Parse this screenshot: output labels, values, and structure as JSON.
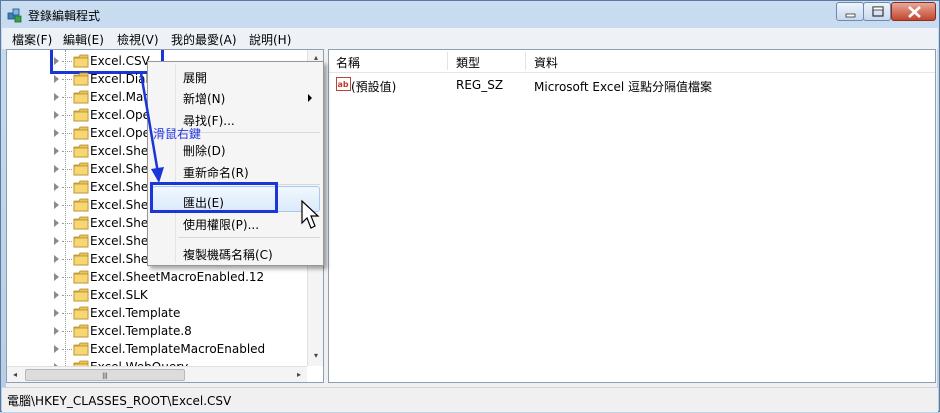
{
  "window": {
    "title": "登錄編輯程式"
  },
  "menubar": {
    "items": [
      "檔案(F)",
      "編輯(E)",
      "檢視(V)",
      "我的最愛(A)",
      "說明(H)"
    ]
  },
  "tree": {
    "items": [
      "Excel.CSV",
      "Excel.Dialo",
      "Excel.Mac",
      "Excel.Ope",
      "Excel.Ope",
      "Excel.Shee",
      "Excel.Shee",
      "Excel.Shee",
      "Excel.Shee",
      "Excel.Shee",
      "Excel.Shee",
      "Excel.Shee",
      "Excel.SheetMacroEnabled.12",
      "Excel.SLK",
      "Excel.Template",
      "Excel.Template.8",
      "Excel.TemplateMacroEnabled",
      "Excel.WebQuery"
    ],
    "scroll_left": "◂",
    "scroll_right": "▸",
    "scroll_up": "▴",
    "scroll_down": "▾",
    "grip": "III"
  },
  "list": {
    "columns": [
      "名稱",
      "類型",
      "資料"
    ],
    "rows": [
      {
        "name": "(預設值)",
        "type": "REG_SZ",
        "data": "Microsoft Excel 逗點分隔值檔案"
      }
    ],
    "value_icon": "ab"
  },
  "context_menu": {
    "items": [
      {
        "label": "展開"
      },
      {
        "label": "新增(N)",
        "submenu": true
      },
      {
        "label": "尋找(F)..."
      },
      {
        "label": "刪除(D)"
      },
      {
        "label": "重新命名(R)"
      },
      {
        "label": "匯出(E)"
      },
      {
        "label": "使用權限(P)..."
      },
      {
        "label": "複製機碼名稱(C)"
      }
    ],
    "highlighted_item": "匯出(E)"
  },
  "annotation": {
    "text": "滑鼠右鍵",
    "color": "#2233dd",
    "box_color": "#1a35d8"
  },
  "statusbar": {
    "path": "電腦\\HKEY_CLASSES_ROOT\\Excel.CSV"
  }
}
